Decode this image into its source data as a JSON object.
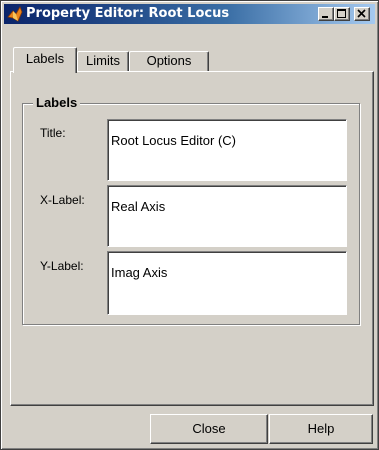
{
  "window": {
    "title": "Property Editor: Root Locus",
    "app_icon": "matlab-icon"
  },
  "title_buttons": [
    "minimize-icon",
    "maximize-icon",
    "close-icon"
  ],
  "tabs": [
    {
      "label": "Labels",
      "active": true
    },
    {
      "label": "Limits",
      "active": false
    },
    {
      "label": "Options",
      "active": false
    }
  ],
  "labels_group": {
    "legend": "Labels",
    "fields": [
      {
        "label": "Title:",
        "value": "Root Locus Editor (C)"
      },
      {
        "label": "X-Label:",
        "value": "Real Axis"
      },
      {
        "label": "Y-Label:",
        "value": "Imag Axis"
      }
    ]
  },
  "buttons": {
    "close": "Close",
    "help": "Help"
  }
}
